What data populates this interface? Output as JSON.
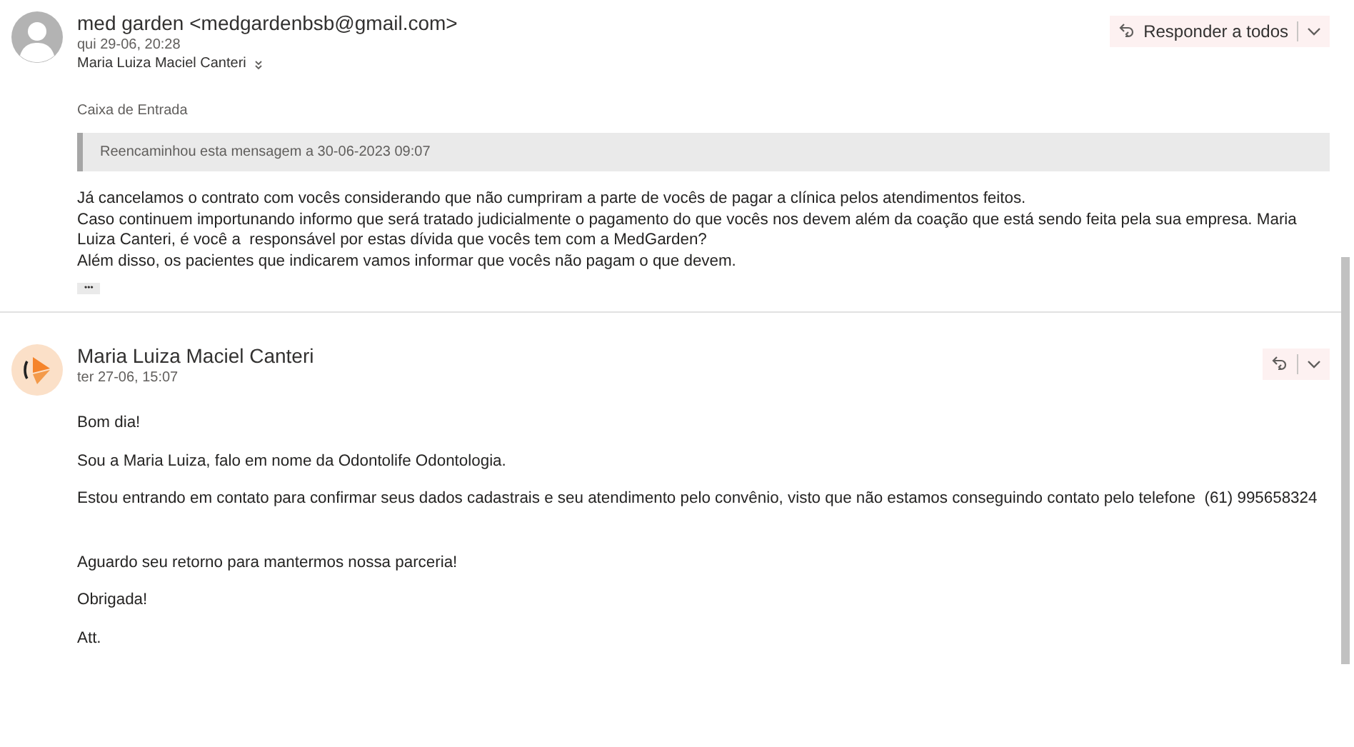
{
  "messages": [
    {
      "avatar": {
        "kind": "person"
      },
      "sender": "med garden <medgardenbsb@gmail.com>",
      "date": "qui 29-06, 20:28",
      "recipient": "Maria Luiza Maciel Canteri",
      "reply": {
        "label": "Responder a todos"
      },
      "folder": "Caixa de Entrada",
      "notice": "Reencaminhou esta mensagem a 30-06-2023 09:07",
      "paragraphs": [
        {
          "lines": [
            "Já cancelamos o contrato com vocês considerando que não cumpriram a parte de vocês de pagar a clínica pelos atendimentos feitos.",
            "Caso continuem importunando informo que será tratado judicialmente o pagamento do que vocês nos devem além da coação que está sendo feita pela sua empresa. Maria Luiza Canteri, é você a  responsável por estas dívida que vocês tem com a MedGarden?",
            "Além disso, os pacientes que indicarem vamos informar que vocês não pagam o que devem."
          ],
          "extra_space": false
        }
      ],
      "more": "•••"
    },
    {
      "avatar": {
        "kind": "logo"
      },
      "sender": "Maria Luiza Maciel Canteri",
      "date": "ter 27-06, 15:07",
      "paragraphs": [
        {
          "lines": [
            "Bom dia!"
          ],
          "extra_space": false
        },
        {
          "lines": [
            "Sou a Maria Luiza, falo em nome da Odontolife Odontologia."
          ],
          "extra_space": false
        },
        {
          "lines": [
            "Estou entrando em contato para confirmar seus dados cadastrais e seu atendimento pelo convênio, visto que não estamos conseguindo contato pelo telefone  (61) 995658324"
          ],
          "extra_space": false
        },
        {
          "lines": [
            "Aguardo seu retorno para mantermos nossa parceria!"
          ],
          "extra_space": true
        },
        {
          "lines": [
            "Obrigada!"
          ],
          "extra_space": false
        },
        {
          "lines": [
            "Att."
          ],
          "extra_space": false
        }
      ]
    }
  ]
}
